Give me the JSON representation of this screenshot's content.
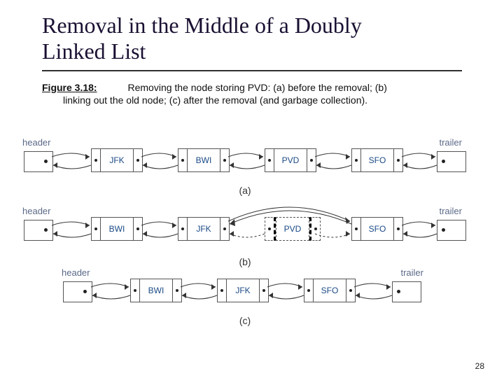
{
  "title_line1": "Removal in the Middle of a Doubly",
  "title_line2": "Linked List",
  "caption": {
    "figure_label": "Figure 3.18:",
    "line1": "Removing the node storing PVD: (a) before the removal; (b)",
    "line2": "linking out the old node; (c) after the removal (and garbage collection)."
  },
  "labels": {
    "header": "header",
    "trailer": "trailer",
    "sub_a": "(a)",
    "sub_b": "(b)",
    "sub_c": "(c)"
  },
  "rows": {
    "a": [
      "JFK",
      "BWI",
      "PVD",
      "SFO"
    ],
    "b": [
      "BWI",
      "JFK",
      "PVD",
      "SFO"
    ],
    "c": [
      "BWI",
      "JFK",
      "SFO"
    ]
  },
  "page_number": "28"
}
